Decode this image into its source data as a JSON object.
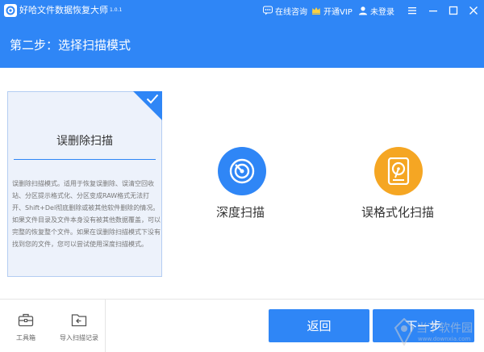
{
  "titlebar": {
    "app_name": "好哈文件数据恢复大师",
    "version": "1.0.1",
    "online_consult": "在线咨询",
    "vip": "开通VIP",
    "login": "未登录"
  },
  "step": {
    "title": "第二步：选择扫描模式"
  },
  "modes": {
    "deleted": {
      "title": "误删除扫描",
      "description": "误删除扫描模式。适用于恢复误删除、误清空回收站、分区提示格式化、分区变成RAW格式无法打开、Shift+Del彻底删除或被其他软件删除的情况。如果文件目录及文件本身没有被其他数据覆盖，可以完整的恢复整个文件。如果在误删除扫描模式下没有找到您的文件，您可以尝试使用深度扫描模式。",
      "selected": true
    },
    "deep": {
      "title": "深度扫描"
    },
    "format": {
      "title": "误格式化扫描"
    }
  },
  "footer": {
    "toolbox": "工具箱",
    "import_record": "导入扫描记录",
    "back": "返回",
    "next": "下一步"
  },
  "watermark": {
    "text": "当下软件园",
    "sub": "www.downxia.com"
  },
  "colors": {
    "primary": "#2f86f6",
    "deep_icon": "#2f86f6",
    "format_icon": "#f5a623"
  }
}
